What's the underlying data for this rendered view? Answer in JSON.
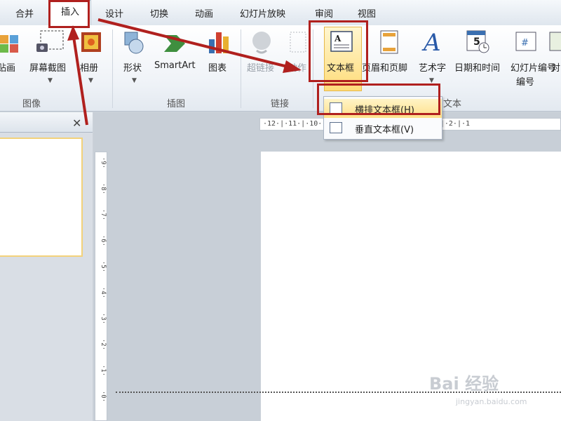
{
  "tabs": [
    "合并",
    "插入",
    "设计",
    "切换",
    "动画",
    "幻灯片放映",
    "审阅",
    "视图"
  ],
  "active_tab": "插入",
  "ribbon": {
    "image_group": {
      "label": "图像",
      "items": [
        "贴画",
        "屏幕截图",
        "相册"
      ]
    },
    "illustration_group": {
      "label": "插图",
      "items": [
        "形状",
        "SmartArt",
        "图表"
      ]
    },
    "link_group": {
      "label": "链接",
      "items": [
        "超链接",
        "动作"
      ]
    },
    "text_group": {
      "label": "文本",
      "items": [
        "文本框",
        "页眉和页脚",
        "艺术字",
        "日期和时间",
        "幻灯片编号",
        "对"
      ]
    },
    "slide_number_line2": "编号",
    "calendar_digit": "5"
  },
  "dropdown": {
    "items": [
      "横排文本框(H)",
      "垂直文本框(V)"
    ]
  },
  "pane": {
    "close": "✕"
  },
  "rulers": {
    "h": "·12·|·11·|·10·|·9·|·8·|·7·|·6·|·5·|·4·|·3·|·2·|·1",
    "v": [
      "·9·",
      "·8·",
      "·7·",
      "·6·",
      "·5·",
      "·4·",
      "·3·",
      "·2·",
      "·1·",
      "·0·"
    ]
  },
  "watermark": {
    "main": "Bai 经验",
    "url": "jingyan.baidu.com"
  },
  "colors": {
    "annotation": "#b0201e",
    "hover": "#ffe08a"
  }
}
